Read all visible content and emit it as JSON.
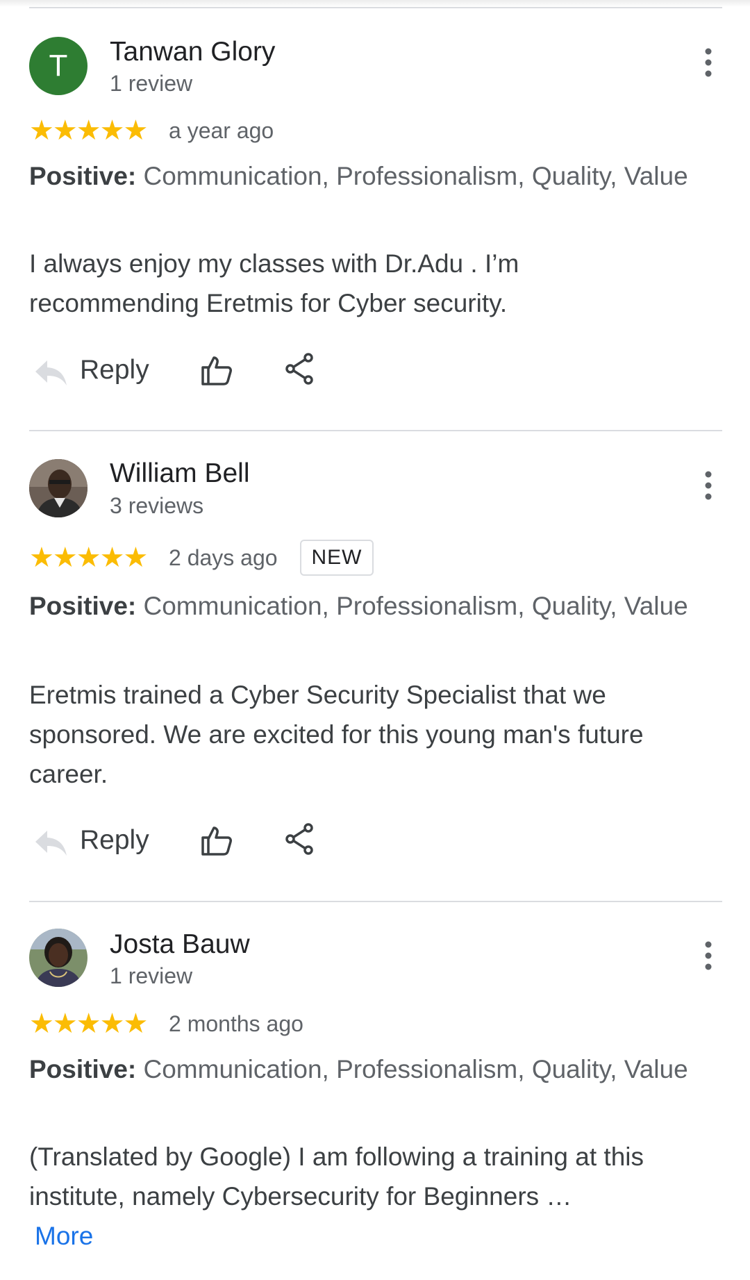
{
  "reviews": [
    {
      "name": "Tanwan Glory",
      "avatar_letter": "T",
      "review_count": "1 review",
      "stars": "★★★★★",
      "rating": 5,
      "time": "a year ago",
      "positive_label": "Positive:",
      "positive_values": " Communication, Professionalism, Quality, Value",
      "text": "I always enjoy my classes with Dr.Adu . I’m recommending Eretmis for Cyber security.",
      "reply_label": "Reply"
    },
    {
      "name": "William Bell",
      "review_count": "3 reviews",
      "stars": "★★★★★",
      "rating": 5,
      "time": "2 days ago",
      "badge": "NEW",
      "positive_label": "Positive:",
      "positive_values": " Communication, Professionalism, Quality, Value",
      "text": "Eretmis trained a Cyber Security Specialist that we sponsored. We are excited for this young man's future career.",
      "reply_label": "Reply"
    },
    {
      "name": "Josta Bauw",
      "review_count": "1 review",
      "stars": "★★★★★",
      "rating": 5,
      "time": "2 months ago",
      "positive_label": "Positive:",
      "positive_values": " Communication, Professionalism, Quality, Value",
      "text": "(Translated by Google) I am following a training at this institute, namely Cybersecurity for Beginners …",
      "more_label": "More"
    }
  ],
  "colors": {
    "star": "#fbbc04",
    "avatar_green": "#2e7d32",
    "link_blue": "#1a73e8",
    "divider": "#dadce0"
  },
  "icons": [
    "reply-icon",
    "thumbs-up-icon",
    "share-icon",
    "more-vert-icon"
  ]
}
